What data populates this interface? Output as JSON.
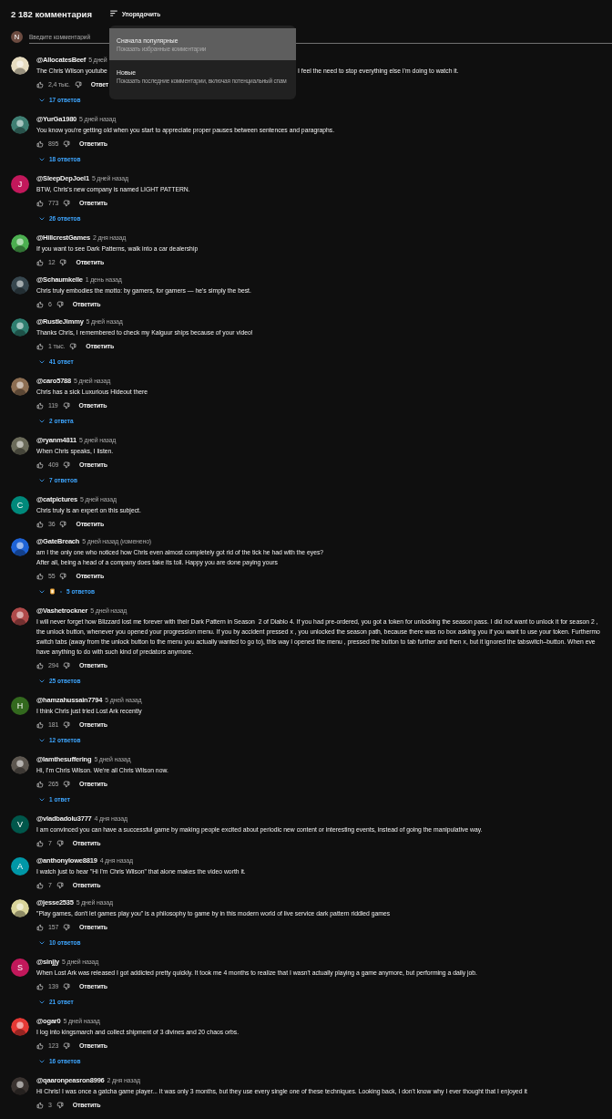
{
  "header": {
    "count": "2 182 комментария",
    "sort_label": "Упорядочить"
  },
  "comment_box": {
    "avatar": {
      "letter": "N",
      "color": "#6d4c41"
    },
    "placeholder": "Введите комментарий"
  },
  "sort_menu": {
    "items": [
      {
        "title": "Сначала популярные",
        "subtitle": "Показать избранные комментарии",
        "selected": true
      },
      {
        "title": "Новые",
        "subtitle": "Показать последние комментарии, включая потенциальный спам",
        "selected": false
      }
    ]
  },
  "comments": [
    {
      "author": "@AllocatesBeef",
      "date": "5 дней",
      "avatar": {
        "kind": "picture",
        "color": "#e6dcc0"
      },
      "segments": [
        "The Chris Wilson youtube",
        "I feel the need to stop everything else I'm doing to watch it."
      ],
      "likes": "2,4 тыс.",
      "reply_label": "Ответ",
      "replies": "17 ответов"
    },
    {
      "author": "@YurGa1980",
      "date": "5 дней назад",
      "avatar": {
        "kind": "picture",
        "color": "#3f7f73"
      },
      "lines": [
        "You know you're getting old when you start to appreciate proper pauses between sentences and paragraphs."
      ],
      "likes": "895",
      "reply_label": "Ответить",
      "replies": "18 ответов"
    },
    {
      "author": "@SleepDepJoel1",
      "date": "5 дней назад",
      "avatar": {
        "kind": "letter",
        "letter": "J",
        "color": "#c2185b"
      },
      "lines": [
        "BTW, Chris's new company is named LIGHT PATTERN."
      ],
      "likes": "773",
      "reply_label": "Ответить",
      "replies": "26 ответов"
    },
    {
      "author": "@HillcrestGames",
      "date": "2 дня назад",
      "avatar": {
        "kind": "picture",
        "color": "#4caf50"
      },
      "lines": [
        "If you want to see Dark Patterns, walk into a car dealership"
      ],
      "likes": "12",
      "reply_label": "Ответить"
    },
    {
      "author": "@Schaumkelle",
      "date": "1 день назад",
      "avatar": {
        "kind": "picture",
        "color": "#37474f"
      },
      "lines": [
        "Chris truly embodies the motto: by gamers, for gamers — he's simply the best."
      ],
      "likes": "6",
      "reply_label": "Ответить"
    },
    {
      "author": "@RustleJimmy",
      "date": "5 дней назад",
      "avatar": {
        "kind": "picture",
        "color": "#2e7d6f"
      },
      "lines": [
        "Thanks Chris, I remembered to check my Kalguur ships because of your video!"
      ],
      "likes": "1 тыс.",
      "reply_label": "Ответить",
      "replies": "41 ответ"
    },
    {
      "author": "@caro5788",
      "date": "5 дней назад",
      "avatar": {
        "kind": "picture",
        "color": "#8d6e52"
      },
      "lines": [
        "Chris has a sick Luxurious Hideout there"
      ],
      "likes": "119",
      "reply_label": "Ответить",
      "replies": "2 ответа"
    },
    {
      "author": "@ryanm4811",
      "date": "5 дней назад",
      "avatar": {
        "kind": "picture",
        "color": "#6b6b5a"
      },
      "lines": [
        "When Chris speaks, I listen."
      ],
      "likes": "409",
      "reply_label": "Ответить",
      "replies": "7 ответов"
    },
    {
      "author": "@catpictures",
      "date": "5 дней назад",
      "avatar": {
        "kind": "letter",
        "letter": "C",
        "color": "#00897b"
      },
      "lines": [
        "Chris truly is an expert on this subject."
      ],
      "likes": "36",
      "reply_label": "Ответить"
    },
    {
      "author": "@GateBreach",
      "date": "5 дней назад (изменено)",
      "avatar": {
        "kind": "picture",
        "color": "#1e63d6"
      },
      "lines": [
        "am I the only one who noticed how Chris even almost completely got rid of the tick he had with the eyes?",
        "After all, being a head of a company does take its toll. Happy you are done paying yours"
      ],
      "likes": "55",
      "reply_label": "Ответить",
      "replies": "5 ответов",
      "creator_replied": true
    },
    {
      "author": "@Vashetrockner",
      "date": "5 дней назад",
      "avatar": {
        "kind": "picture",
        "color": "#b04a4a"
      },
      "lines": [
        "I will never forget how Blizzard lost me forever with their Dark Pattern in Season  2 of Diablo 4. If you had pre-ordered, you got a token for unlocking the season pass. I did not want to unlock it for season 2 ,",
        "the unlock button, whenever you opened your progression menu. If you by accident pressed x , you unlocked the season path, because there was no box asking you if you want to use your token. Furthermo",
        "switch tabs (away from the unlock button to the menu you actually wanted to go to), this way I opened the menu , pressed the button to tab further and then x, but it ignored the tabswitch–button. When eve",
        "have anything to do with such kind of predators anymore."
      ],
      "likes": "294",
      "reply_label": "Ответить",
      "replies": "25 ответов"
    },
    {
      "author": "@hamzahussain7794",
      "date": "5 дней назад",
      "avatar": {
        "kind": "letter",
        "letter": "H",
        "color": "#33691e"
      },
      "lines": [
        "I think Chris just tried Lost Ark recently"
      ],
      "likes": "181",
      "reply_label": "Ответить",
      "replies": "12 ответов"
    },
    {
      "author": "@Iamthesuffering",
      "date": "5 дней назад",
      "avatar": {
        "kind": "picture",
        "color": "#5d5750"
      },
      "lines": [
        "Hi, I'm Chris Wilson. We're all Chris Wilson now."
      ],
      "likes": "265",
      "reply_label": "Ответить",
      "replies": "1 ответ"
    },
    {
      "author": "@vladbadolu3777",
      "date": "4 дня назад",
      "avatar": {
        "kind": "letter",
        "letter": "V",
        "color": "#00574b"
      },
      "lines": [
        "I am convinced you can have a successful game by making people excited about periodic new content or interesting events, instead of going the manipulative way."
      ],
      "likes": "7",
      "reply_label": "Ответить"
    },
    {
      "author": "@anthonylowe8819",
      "date": "4 дня назад",
      "avatar": {
        "kind": "letter",
        "letter": "A",
        "color": "#0097a7"
      },
      "lines": [
        "I watch just to hear \"Hi I'm Chris Wilson\" that alone makes the video worth it."
      ],
      "likes": "7",
      "reply_label": "Ответить"
    },
    {
      "author": "@jesse2535",
      "date": "5 дней назад",
      "avatar": {
        "kind": "picture",
        "color": "#d9d49a"
      },
      "lines": [
        "\"Play games, don't let games play you\" is a philosophy to game by in this modern world of live service dark pattern riddled games"
      ],
      "likes": "157",
      "reply_label": "Ответить",
      "replies": "10 ответов"
    },
    {
      "author": "@sinjjy",
      "date": "5 дней назад",
      "avatar": {
        "kind": "letter",
        "letter": "S",
        "color": "#c2185b"
      },
      "lines": [
        "When Lost Ark was released I got addicted pretty quickly. It took me 4 months to realize that I wasn't actually playing a game anymore, but performing a daily job."
      ],
      "likes": "139",
      "reply_label": "Ответить",
      "replies": "21 ответ"
    },
    {
      "author": "@ogar0",
      "date": "5 дней назад",
      "avatar": {
        "kind": "picture",
        "color": "#e53935"
      },
      "lines": [
        "I log into kingsmarch and collect shipment of 3 divines and 20 chaos orbs."
      ],
      "likes": "123",
      "reply_label": "Ответить",
      "replies": "16 ответов"
    },
    {
      "author": "@qaaronpeasron8996",
      "date": "2 дня назад",
      "avatar": {
        "kind": "picture",
        "color": "#3a3330"
      },
      "lines": [
        "Hi Chris! I was once a gatcha game player... It was only 3 months, but they use every single one of these techniques. Looking back, I don't know why I ever thought that I enjoyed it"
      ],
      "likes": "3",
      "reply_label": "Ответить"
    }
  ]
}
